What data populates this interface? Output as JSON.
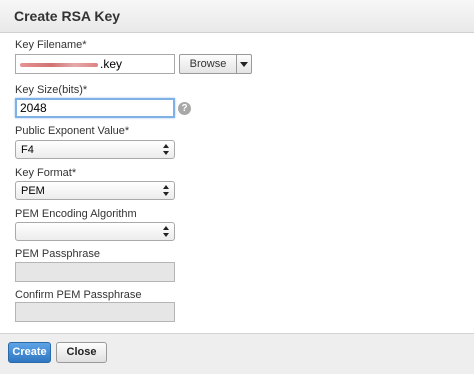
{
  "dialog": {
    "title": "Create RSA Key"
  },
  "fields": {
    "key_filename": {
      "label": "Key Filename*",
      "value_suffix": ".key",
      "browse_label": "Browse"
    },
    "key_size": {
      "label": "Key Size(bits)*",
      "value": "2048",
      "help_icon": "?"
    },
    "public_exponent": {
      "label": "Public Exponent Value*",
      "selected": "F4"
    },
    "key_format": {
      "label": "Key Format*",
      "selected": "PEM"
    },
    "pem_encoding": {
      "label": "PEM Encoding Algorithm",
      "selected": ""
    },
    "pem_passphrase": {
      "label": "PEM Passphrase"
    },
    "confirm_pem_passphrase": {
      "label": "Confirm PEM Passphrase"
    }
  },
  "footer": {
    "create_label": "Create",
    "close_label": "Close"
  },
  "colors": {
    "primary_button": "#3a85cf",
    "focus_ring": "#7fb1e6",
    "disabled_field": "#e6e6e6"
  },
  "icons": {
    "help": "help-icon",
    "dropdown": "chevron-down-icon",
    "select_arrows": "updown-arrows-icon"
  }
}
